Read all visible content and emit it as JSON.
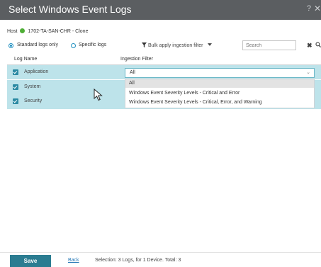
{
  "dialog": {
    "title": "Select Windows Event Logs",
    "help_glyph": "?",
    "close_glyph": "✕"
  },
  "host": {
    "label": "Host",
    "name": "1702-TA-SAN-CHR - Clone",
    "status_color": "#4fae36"
  },
  "options": {
    "standard_label": "Standard logs only",
    "specific_label": "Specific logs",
    "selected": "standard",
    "bulk_filter_label": "Bulk apply ingestion filter"
  },
  "search": {
    "placeholder": "Search",
    "clear_glyph": "✖"
  },
  "table": {
    "headers": {
      "log_name": "Log Name",
      "ingestion_filter": "Ingestion Filter"
    },
    "rows": [
      {
        "label": "Application",
        "checked": true
      },
      {
        "label": "System",
        "checked": true
      },
      {
        "label": "Security",
        "checked": true
      }
    ],
    "selected_row_color": "#bde3ea"
  },
  "filter_select": {
    "value": "All",
    "open": true,
    "options": [
      "All",
      "Windows Event Severity Levels - Critical and Error",
      "Windows Event Severity Levels - Critical, Error, and Warning"
    ]
  },
  "footer": {
    "save_label": "Save",
    "back_label": "Back",
    "selection_text": "Selection: 3 Logs, for 1 Device. Total: 3"
  },
  "colors": {
    "titlebar": "#5b5e61",
    "accent": "#2b7c91",
    "link": "#2a7bb8"
  }
}
